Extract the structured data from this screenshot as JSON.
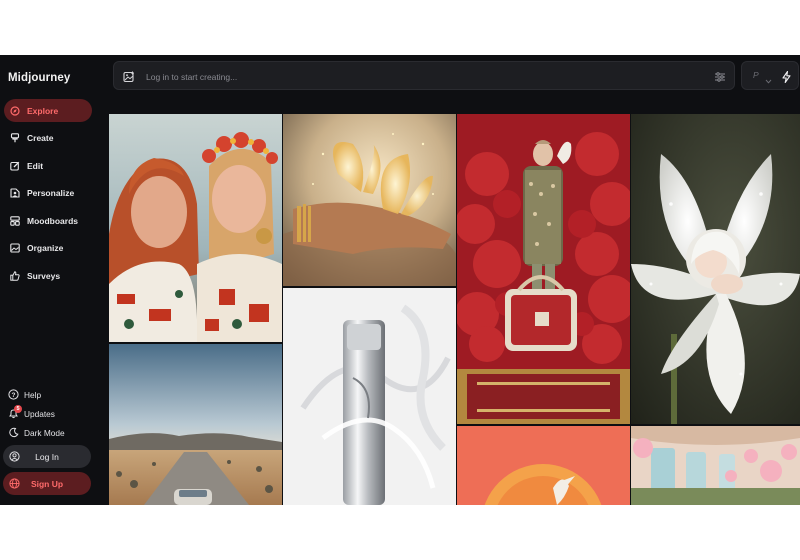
{
  "app": {
    "brand": "Midjourney",
    "accent": "#ff6b6b",
    "accent_bg": "#5c1d20"
  },
  "sidebar": {
    "items": [
      {
        "label": "Explore",
        "icon": "compass-icon",
        "active": true
      },
      {
        "label": "Create",
        "icon": "brush-icon"
      },
      {
        "label": "Edit",
        "icon": "edit-icon"
      },
      {
        "label": "Personalize",
        "icon": "user-profile-icon"
      },
      {
        "label": "Moodboards",
        "icon": "grid-icon"
      },
      {
        "label": "Organize",
        "icon": "folder-image-icon"
      },
      {
        "label": "Surveys",
        "icon": "thumbs-up-icon"
      }
    ],
    "bottom": {
      "help": "Help",
      "updates": "Updates",
      "updates_badge": "5",
      "dark_mode": "Dark Mode"
    },
    "login": "Log In",
    "signup": "Sign Up"
  },
  "topbar": {
    "search_placeholder": "Log in to start creating...",
    "mini_label": "P"
  },
  "gallery": {
    "tiles": [
      {
        "subject": "two-women-folk-costume"
      },
      {
        "subject": "butterflies-on-hands"
      },
      {
        "subject": "desert-road-car"
      },
      {
        "subject": "silver-bottle-abstract"
      },
      {
        "subject": "person-with-bag-red-trees"
      },
      {
        "subject": "orange-circle-bird"
      },
      {
        "subject": "white-lily-baby"
      },
      {
        "subject": "pink-balloons-train"
      }
    ]
  }
}
